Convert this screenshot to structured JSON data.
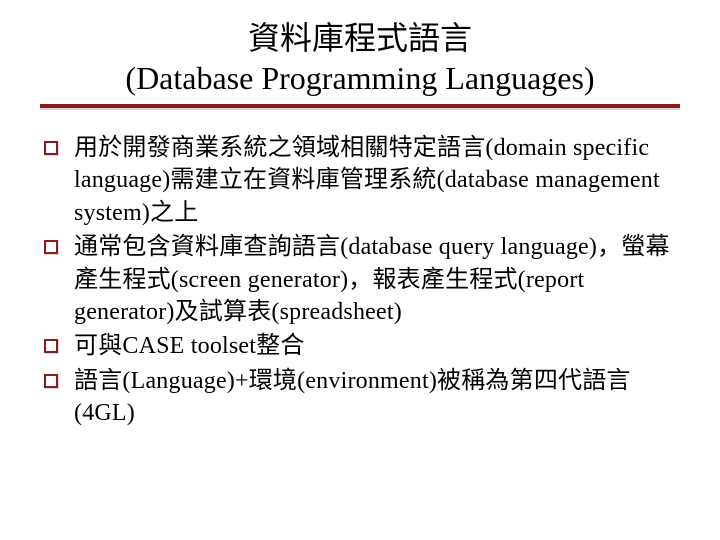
{
  "title": {
    "line1": "資料庫程式語言",
    "line2": "(Database Programming Languages)"
  },
  "bullets": [
    "用於開發商業系統之領域相關特定語言(domain specific language)需建立在資料庫管理系統(database management system)之上",
    "通常包含資料庫查詢語言(database query language)，螢幕產生程式(screen generator)，報表產生程式(report generator)及試算表(spreadsheet)",
    "可與CASE toolset整合",
    "語言(Language)+環境(environment)被稱為第四代語言(4GL)"
  ],
  "colors": {
    "accent": "#8b1a1a"
  }
}
